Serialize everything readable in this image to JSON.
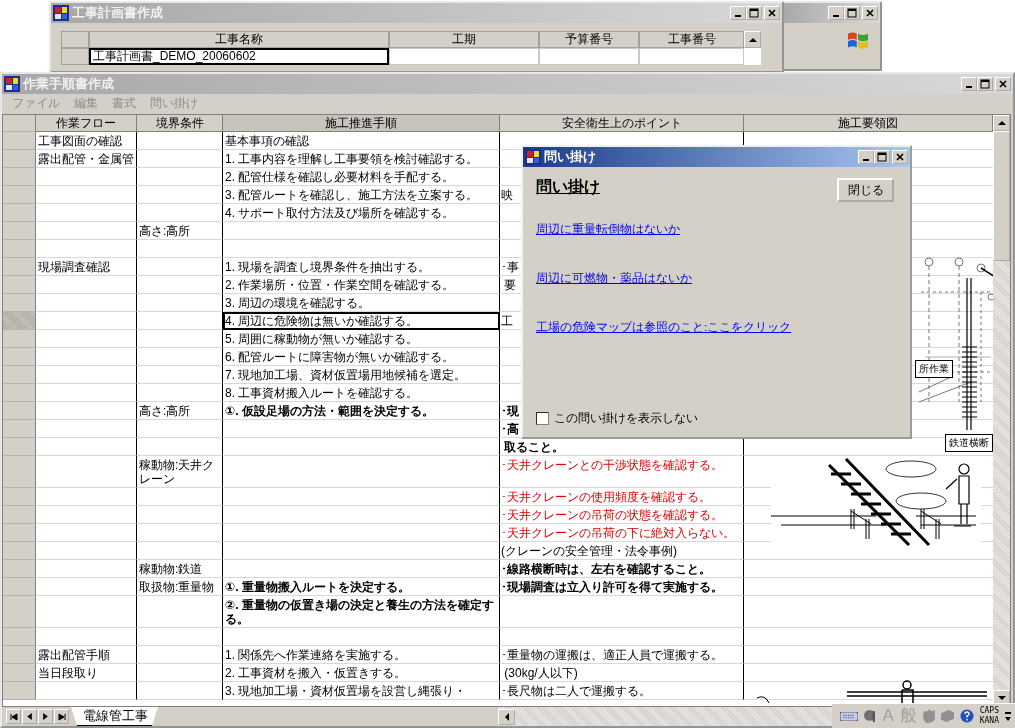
{
  "back_window": {
    "title": "工事計画書作成",
    "columns": [
      "工事名称",
      "工期",
      "予算番号",
      "工事番号"
    ],
    "rows": [
      {
        "name": "工事計画書_DEMO_20060602",
        "selected": true
      }
    ]
  },
  "main_window": {
    "title": "作業手順書作成",
    "menu": [
      "ファイル",
      "編集",
      "書式",
      "問い掛け"
    ]
  },
  "sheet": {
    "columns": [
      "作業フロー",
      "境界条件",
      "施工推進手順",
      "安全衛生上のポイント",
      "施工要領図"
    ],
    "rows": [
      {
        "flow": "工事図面の確認",
        "step": "基本事項の確認",
        "step_bold": false,
        "selected": false
      },
      {
        "flow": "露出配管・金属管",
        "step": "1. 工事内容を理解し工事要領を検討確認する。",
        "step_bold": false,
        "selected": false
      },
      {
        "step": "2. 配管仕様を確認し必要材料を手配する。",
        "step_bold": false,
        "selected": false
      },
      {
        "step": "3. 配管ルートを確認し、施工方法を立案する。",
        "step_bold": false,
        "point": "映",
        "point_bold": false,
        "point_alert": false,
        "selected": false
      },
      {
        "step": "4. サポート取付方法及び場所を確認する。",
        "step_bold": false,
        "selected": false
      },
      {
        "condition": "高さ:高所",
        "selected": false
      },
      {
        "selected": false
      },
      {
        "flow": "現場調査確認",
        "step": "1. 現場を調査し境界条件を抽出する。",
        "step_bold": false,
        "point": "･事",
        "point_bold": false,
        "point_alert": false,
        "selected": false
      },
      {
        "step": "2. 作業場所・位置・作業空間を確認する。",
        "step_bold": false,
        "point": " 要",
        "point_bold": false,
        "point_alert": false,
        "selected": false
      },
      {
        "step": "3. 周辺の環境を確認する。",
        "step_bold": false,
        "selected": false
      },
      {
        "step": "4. 周辺に危険物は無いか確認する。",
        "step_bold": false,
        "point": "工",
        "point_bold": false,
        "point_alert": false,
        "selected": true
      },
      {
        "step": "5. 周囲に稼動物が無いか確認する。",
        "step_bold": false,
        "selected": false
      },
      {
        "step": "6. 配管ルートに障害物が無いか確認する。",
        "step_bold": false,
        "selected": false
      },
      {
        "step": "7. 現地加工場、資材仮置場用地候補を選定。",
        "step_bold": false,
        "selected": false
      },
      {
        "step": "8. 工事資材搬入ルートを確認する。",
        "step_bold": false,
        "selected": false
      },
      {
        "condition": "高さ:高所",
        "step": "①. 仮設足場の方法・範囲を決定する。",
        "step_bold": true,
        "point": "･現",
        "point_bold": true,
        "point_alert": false,
        "selected": false
      },
      {
        "point": "･高",
        "point_bold": true,
        "point_alert": false,
        "selected": false
      },
      {
        "point": " 取ること。",
        "point_bold": true,
        "point_alert": false,
        "selected": false
      },
      {
        "condition": "稼動物:天井クレーン",
        "point": "･天井クレーンとの干渉状態を確認する。",
        "point_bold": false,
        "point_alert": true,
        "selected": false
      },
      {
        "point": "･天井クレーンの使用頻度を確認する。",
        "point_bold": false,
        "point_alert": true,
        "selected": false
      },
      {
        "point": "･天井クレーンの吊荷の状態を確認する。",
        "point_bold": false,
        "point_alert": true,
        "selected": false
      },
      {
        "point": "･天井クレーンの吊荷の下に絶対入らない。",
        "point_bold": false,
        "point_alert": true,
        "selected": false
      },
      {
        "point": "(クレーンの安全管理・法令事例)",
        "point_bold": false,
        "point_alert": false,
        "selected": false
      },
      {
        "condition": "稼動物:鉄道",
        "point": "･線路横断時は、左右を確認すること。",
        "point_bold": true,
        "point_alert": false,
        "selected": false
      },
      {
        "condition": "取扱物:重量物",
        "step": "①. 重量物搬入ルートを決定する。",
        "step_bold": true,
        "point": "･現場調査は立入り許可を得て実施する。",
        "point_bold": true,
        "point_alert": false,
        "selected": false
      },
      {
        "step": "②. 重量物の仮置き場の決定と養生の方法を確定する。",
        "step_bold": true,
        "selected": false
      },
      {
        "selected": false
      },
      {
        "flow": "露出配管手順",
        "step": "1. 関係先へ作業連絡を実施する。",
        "step_bold": false,
        "point": "･重量物の運搬は、適正人員で運搬する。",
        "point_bold": false,
        "point_alert": false,
        "selected": false
      },
      {
        "flow": "当日段取り",
        "step": "2. 工事資材を搬入・仮置きする。",
        "step_bold": false,
        "point": " (30kg/人以下)",
        "point_bold": false,
        "point_alert": false,
        "selected": false
      },
      {
        "step": "3. 現地加工場・資材仮置場を設営し縄張り・",
        "step_bold": false,
        "point": "･長尺物は二人で運搬する。",
        "point_bold": false,
        "point_alert": false,
        "selected": false
      }
    ],
    "diagram_labels": [
      "所作業",
      "鉄道横断"
    ]
  },
  "sheet_tabs": [
    {
      "label": "電線管工事",
      "selected": true
    }
  ],
  "ime_bar": {
    "mode": "A",
    "dictionary": "般",
    "caps": "CAPS",
    "kana": "KANA"
  },
  "dialog": {
    "title": "問い掛け",
    "heading": "問い掛け",
    "close_button": "閉じる",
    "links": [
      "周辺に重量転倒物はないか",
      "周辺に可燃物・薬品はないか",
      "工場の危険マップは参照のこと:ここをクリック"
    ],
    "checkbox": {
      "label": "この問い掛けを表示しない",
      "checked": false
    }
  }
}
